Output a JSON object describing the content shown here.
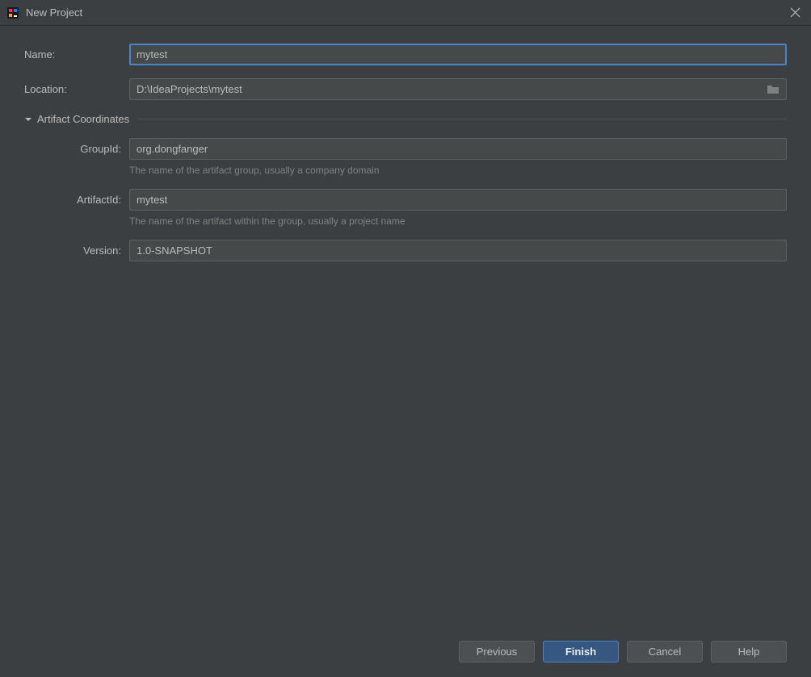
{
  "titlebar": {
    "title": "New Project"
  },
  "form": {
    "name_label": "Name:",
    "name_value": "mytest",
    "location_label": "Location:",
    "location_value": "D:\\IdeaProjects\\mytest"
  },
  "artifact": {
    "section_title": "Artifact Coordinates",
    "group_label": "GroupId:",
    "group_value": "org.dongfanger",
    "group_hint": "The name of the artifact group, usually a company domain",
    "artifact_label": "ArtifactId:",
    "artifact_value": "mytest",
    "artifact_hint": "The name of the artifact within the group, usually a project name",
    "version_label": "Version:",
    "version_value": "1.0-SNAPSHOT"
  },
  "buttons": {
    "previous": "Previous",
    "finish": "Finish",
    "cancel": "Cancel",
    "help": "Help"
  }
}
